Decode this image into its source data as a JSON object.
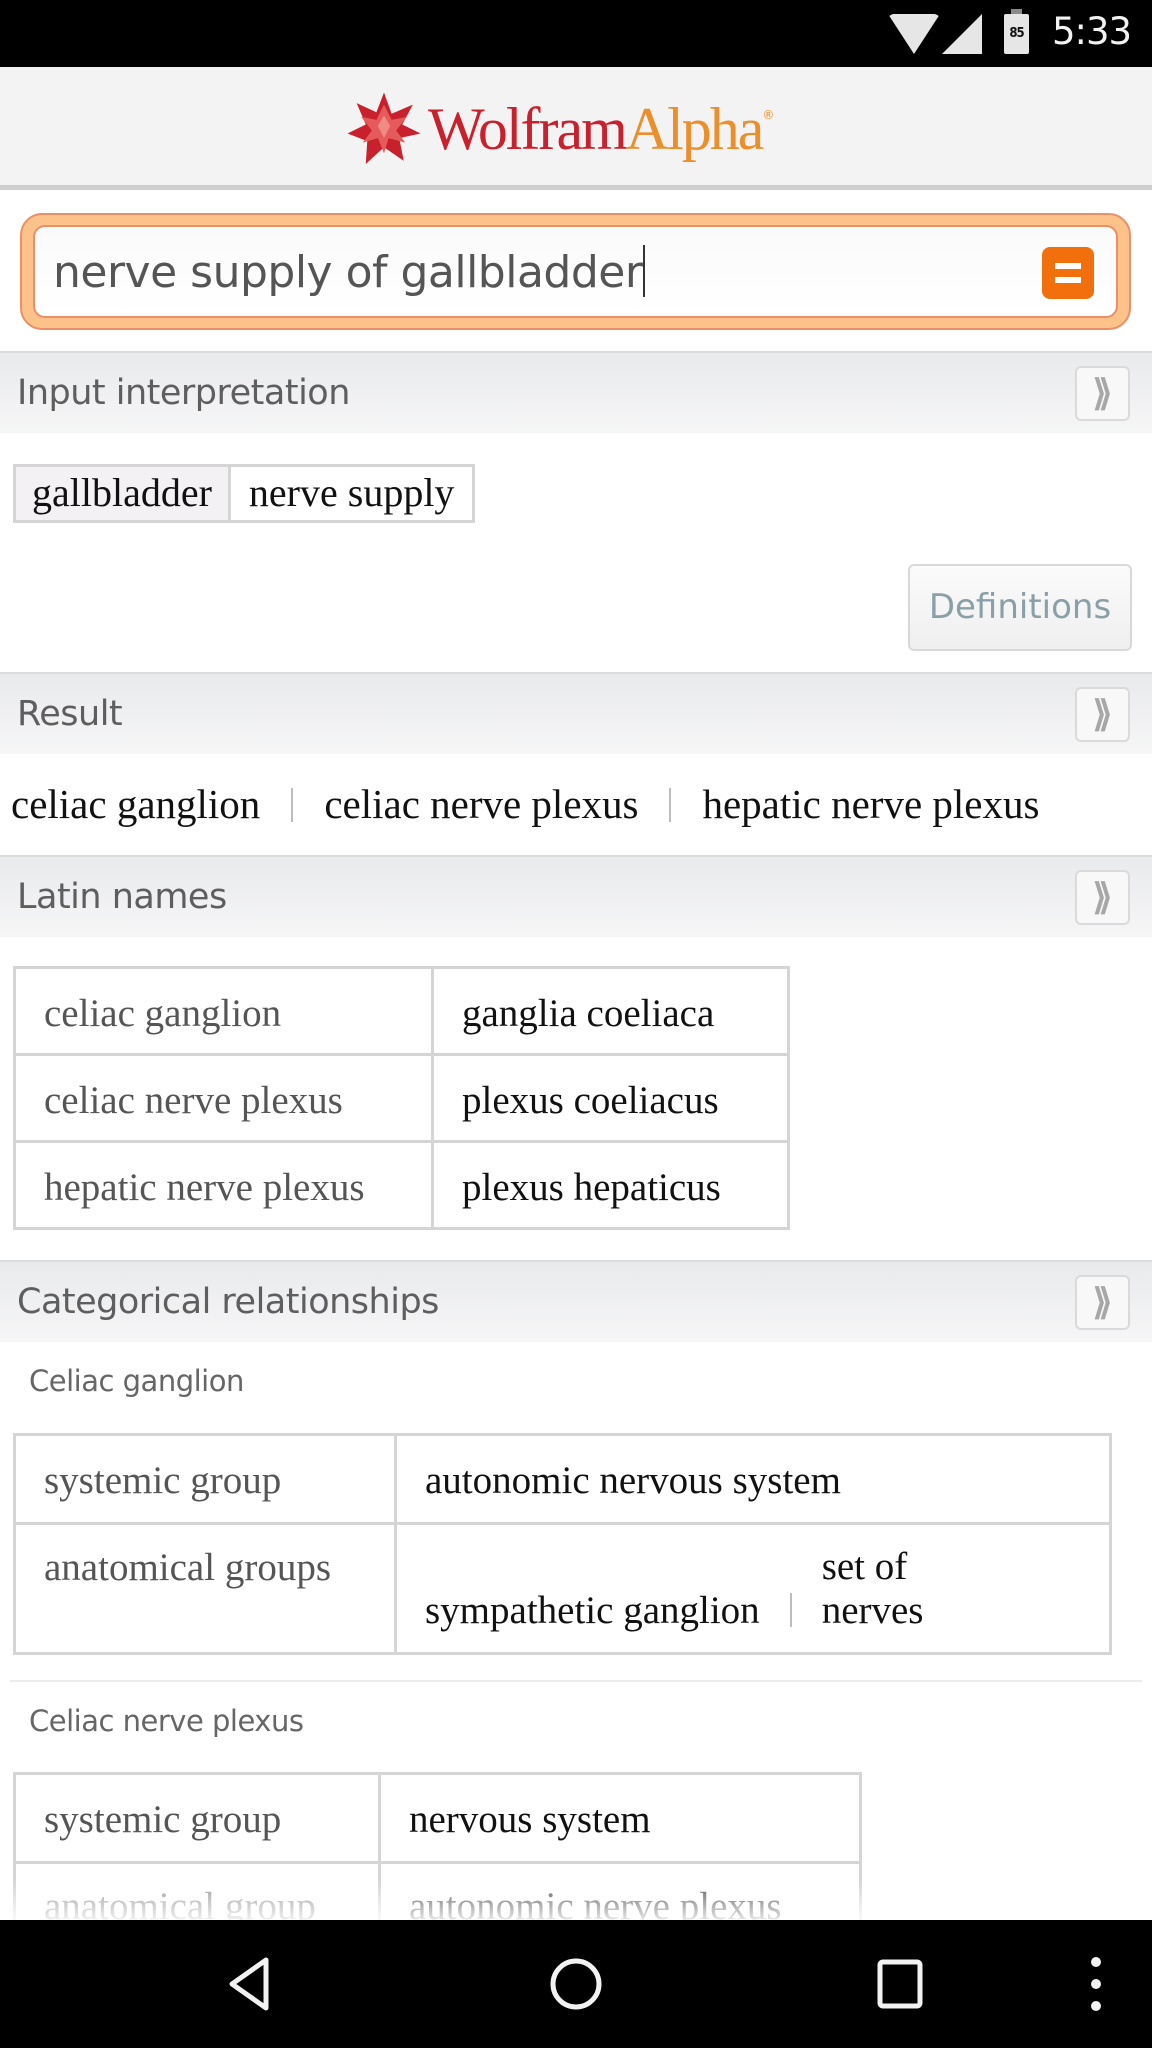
{
  "status_bar": {
    "time": "5:33",
    "battery_level": "85",
    "icons": [
      "wifi-icon",
      "cell-signal-icon",
      "battery-icon"
    ]
  },
  "app": {
    "logo_primary": "Wolfram",
    "logo_secondary": "Alpha",
    "logo_mark": "®",
    "brand_colors": {
      "red": "#c8202c",
      "orange": "#eb8f2d"
    }
  },
  "search": {
    "value": "nerve supply of gallbladder",
    "submit_icon": "equals-icon",
    "accent": "#f26f0d"
  },
  "pods": {
    "input_interpretation": {
      "title": "Input interpretation",
      "cells": [
        "gallbladder",
        "nerve supply"
      ],
      "definitions_button": "Definitions"
    },
    "result": {
      "title": "Result",
      "items": [
        "celiac ganglion",
        "celiac nerve plexus",
        "hepatic nerve plexus"
      ]
    },
    "latin_names": {
      "title": "Latin names",
      "rows": [
        [
          "celiac ganglion",
          "ganglia coeliaca"
        ],
        [
          "celiac nerve plexus",
          "plexus coeliacus"
        ],
        [
          "hepatic nerve plexus",
          "plexus hepaticus"
        ]
      ]
    },
    "categorical": {
      "title": "Categorical relationships",
      "groups": [
        {
          "label": "Celiac ganglion",
          "rows": [
            {
              "key": "systemic group",
              "values": [
                "autonomic nervous system"
              ]
            },
            {
              "key": "anatomical groups",
              "values": [
                "sympathetic ganglion",
                "set of nerves"
              ]
            }
          ]
        },
        {
          "label": "Celiac nerve plexus",
          "rows": [
            {
              "key": "systemic group",
              "values": [
                "nervous system"
              ]
            },
            {
              "key": "anatomical group",
              "values": [
                "autonomic nerve plexus"
              ]
            }
          ]
        }
      ]
    },
    "expand_icon": "double-chevron-right-icon"
  },
  "nav_bar": {
    "buttons": [
      "back",
      "home",
      "recents",
      "menu"
    ]
  }
}
